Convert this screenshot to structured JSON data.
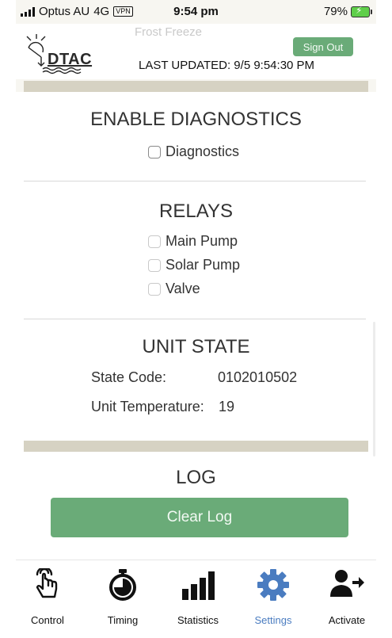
{
  "status_bar": {
    "carrier": "Optus AU",
    "network": "4G",
    "vpn": "VPN",
    "time": "9:54 pm",
    "battery": "79%"
  },
  "header": {
    "logo_text": "DTAC",
    "ghost_text": "Frost Freeze",
    "sign_out_label": "Sign Out",
    "last_updated": "LAST UPDATED: 9/5 9:54:30 PM"
  },
  "diagnostics": {
    "title": "ENABLE DIAGNOSTICS",
    "checkbox_label": "Diagnostics",
    "checked": false
  },
  "relays": {
    "title": "RELAYS",
    "items": [
      {
        "label": "Main Pump",
        "checked": false
      },
      {
        "label": "Solar Pump",
        "checked": false
      },
      {
        "label": "Valve",
        "checked": false
      }
    ]
  },
  "unit_state": {
    "title": "UNIT STATE",
    "state_code_label": "State Code:",
    "state_code_value": "0102010502",
    "temperature_label": "Unit Temperature:",
    "temperature_value": "19"
  },
  "log": {
    "title": "LOG",
    "clear_label": "Clear Log"
  },
  "tabs": [
    {
      "label": "Control",
      "icon": "hand-pointer-icon",
      "active": false
    },
    {
      "label": "Timing",
      "icon": "stopwatch-icon",
      "active": false
    },
    {
      "label": "Statistics",
      "icon": "bar-chart-icon",
      "active": false
    },
    {
      "label": "Settings",
      "icon": "gear-icon",
      "active": true
    },
    {
      "label": "Activate",
      "icon": "user-arrow-icon",
      "active": false
    }
  ],
  "colors": {
    "accent_green": "#6aab78",
    "active_tab": "#4a7cc0",
    "divider_tan": "#d6d2c3"
  }
}
